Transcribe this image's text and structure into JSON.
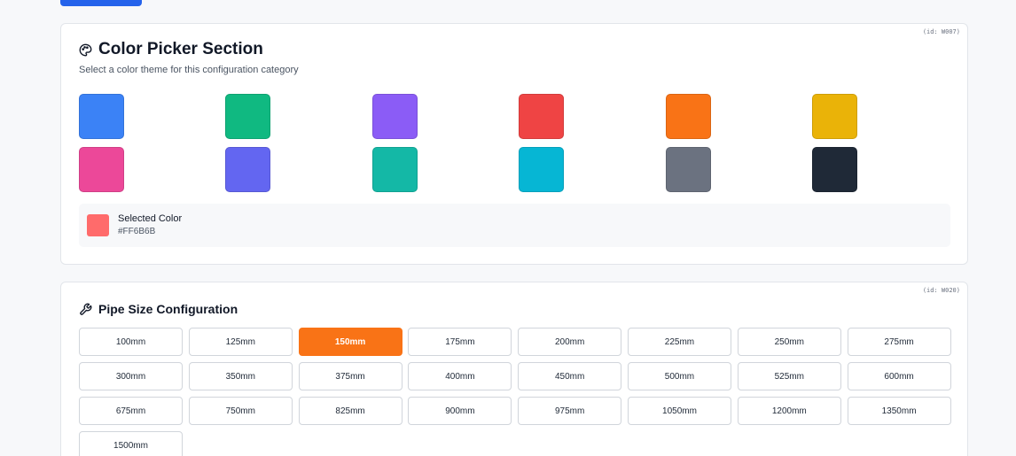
{
  "color_section": {
    "id_label": "(id: W007)",
    "title": "Color Picker Section",
    "subtitle": "Select a color theme for this configuration category",
    "icon": "palette-icon",
    "swatches": [
      "#3b82f6",
      "#10b981",
      "#8b5cf6",
      "#ef4444",
      "#f97316",
      "#eab308",
      "#ec4899",
      "#6366f1",
      "#14b8a6",
      "#06b6d4",
      "#6b7280",
      "#1f2937"
    ],
    "selected": {
      "label": "Selected Color",
      "hex": "#FF6B6B",
      "color": "#ff6b6b"
    }
  },
  "pipe_section": {
    "id_label": "(id: W020)",
    "title": "Pipe Size Configuration",
    "icon": "wrench-icon",
    "selected_index": 2,
    "sizes": [
      "100mm",
      "125mm",
      "150mm",
      "175mm",
      "200mm",
      "225mm",
      "250mm",
      "275mm",
      "300mm",
      "350mm",
      "375mm",
      "400mm",
      "450mm",
      "500mm",
      "525mm",
      "600mm",
      "675mm",
      "750mm",
      "825mm",
      "900mm",
      "975mm",
      "1050mm",
      "1200mm",
      "1350mm",
      "1500mm"
    ],
    "accent": "#f97316"
  },
  "top_button": {
    "color": "#2563eb"
  }
}
